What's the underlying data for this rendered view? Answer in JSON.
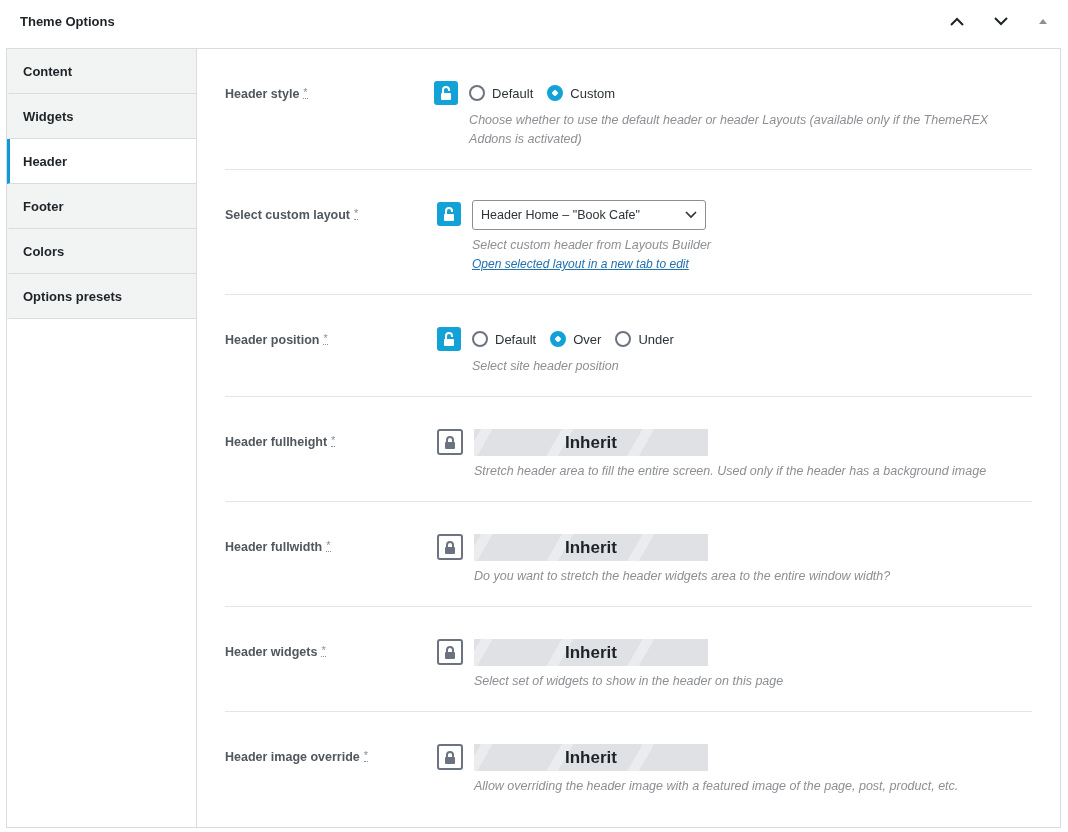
{
  "panel": {
    "title": "Theme Options"
  },
  "tabs": [
    {
      "label": "Content",
      "selected": false
    },
    {
      "label": "Widgets",
      "selected": false
    },
    {
      "label": "Header",
      "selected": true
    },
    {
      "label": "Footer",
      "selected": false
    },
    {
      "label": "Colors",
      "selected": false
    },
    {
      "label": "Options presets",
      "selected": false
    }
  ],
  "options": [
    {
      "kind": "radio",
      "label": "Header style",
      "mark": "*",
      "locked": false,
      "choices": [
        {
          "label": "Default",
          "selected": false
        },
        {
          "label": "Custom",
          "selected": true
        }
      ],
      "description": "Choose whether to use the default header or header Layouts (available only if the ThemeREX Addons is activated)"
    },
    {
      "kind": "select",
      "label": "Select custom layout",
      "mark": "*",
      "locked": false,
      "value": "Header Home – \"Book Cafe\"",
      "description": "Select custom header from Layouts Builder",
      "link": "Open selected layout in a new tab to edit"
    },
    {
      "kind": "radio",
      "label": "Header position",
      "mark": "*",
      "locked": false,
      "choices": [
        {
          "label": "Default",
          "selected": false
        },
        {
          "label": "Over",
          "selected": true
        },
        {
          "label": "Under",
          "selected": false
        }
      ],
      "description": "Select site header position"
    },
    {
      "kind": "inherit",
      "label": "Header fullheight",
      "mark": "*",
      "locked": true,
      "value": "Inherit",
      "description": "Stretch header area to fill the entire screen. Used only if the header has a background image"
    },
    {
      "kind": "inherit",
      "label": "Header fullwidth",
      "mark": "*",
      "locked": true,
      "value": "Inherit",
      "description": "Do you want to stretch the header widgets area to the entire window width?"
    },
    {
      "kind": "inherit",
      "label": "Header widgets",
      "mark": "*",
      "locked": true,
      "value": "Inherit",
      "description": "Select set of widgets to show in the header on this page"
    },
    {
      "kind": "inherit",
      "label": "Header image override",
      "mark": "*",
      "locked": true,
      "value": "Inherit",
      "description": "Allow overriding the header image with a featured image of the page, post, product, etc."
    }
  ]
}
